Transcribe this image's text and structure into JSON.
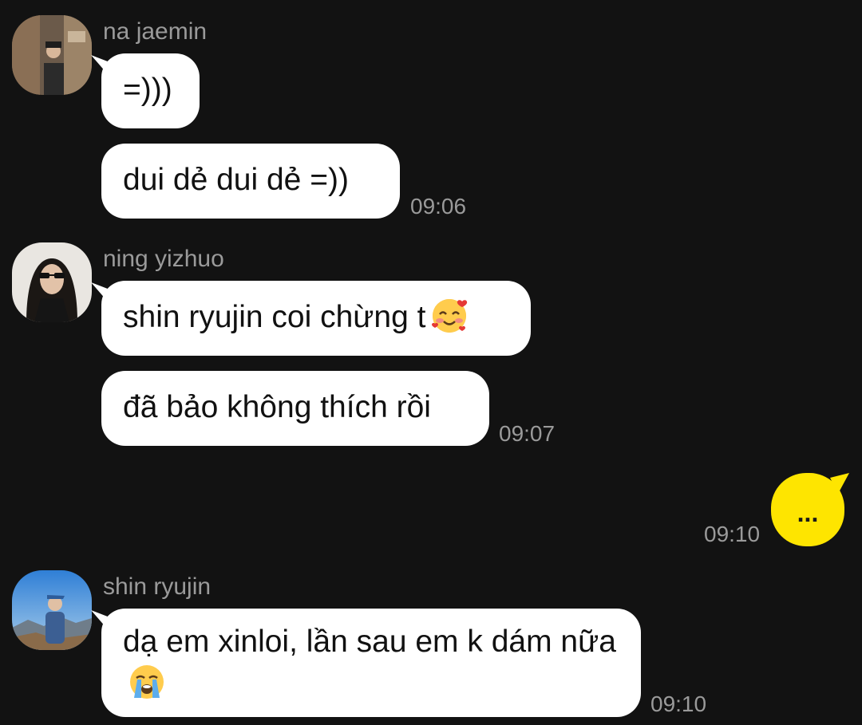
{
  "messages": [
    {
      "sender": "na jaemin",
      "avatar_icon": "avatar-na-jaemin",
      "bubbles": [
        "=)))",
        "dui dẻ dui dẻ =))"
      ],
      "time": "09:06"
    },
    {
      "sender": "ning yizhuo",
      "avatar_icon": "avatar-ning-yizhuo",
      "bubbles": [
        "shin ryujin coi chừng t",
        "đã bảo không thích rồi"
      ],
      "bubble_emoji": "smiling-face-with-hearts-emoji",
      "time": "09:07"
    },
    {
      "sender": "me",
      "bubbles": [
        "..."
      ],
      "time": "09:10"
    },
    {
      "sender": "shin ryujin",
      "avatar_icon": "avatar-shin-ryujin",
      "bubbles": [
        "dạ em xinloi, lần sau em k dám nữa"
      ],
      "bubble_emoji": "loudly-crying-face-emoji",
      "time": "09:10"
    }
  ],
  "colors": {
    "background": "#121212",
    "incoming_bubble": "#ffffff",
    "outgoing_bubble": "#fee500",
    "meta_text": "#9a9a9a"
  }
}
